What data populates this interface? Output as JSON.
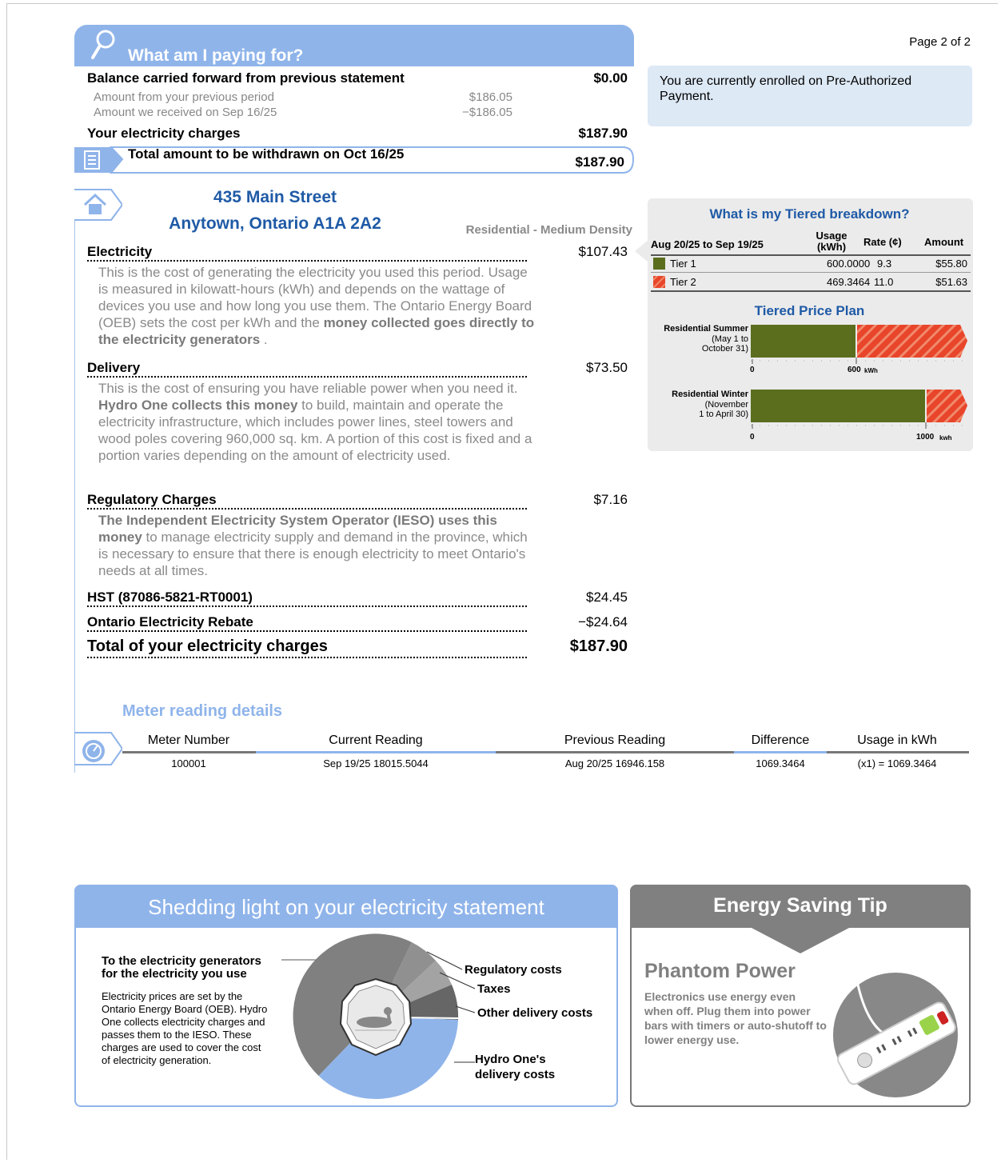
{
  "page_label": "Page 2 of 2",
  "summary": {
    "title": "What am I paying for?",
    "balance_label": "Balance carried forward from previous statement",
    "balance_value": "$0.00",
    "prev_amount_label": "Amount from your previous period",
    "prev_amount_value": "$186.05",
    "received_label": "Amount we received on Sep 16/25",
    "received_value": "−$186.05",
    "electricity_charges_label": "Your electricity charges",
    "electricity_charges_value": "$187.90",
    "withdraw_label": "Total amount to be withdrawn on Oct 16/25",
    "withdraw_value": "$187.90"
  },
  "enrollment_note": "You are currently enrolled on Pre-Authorized Payment.",
  "address": {
    "line1": "435 Main Street",
    "line2": "Anytown, Ontario A1A 2A2",
    "rate_class": "Residential - Medium Density"
  },
  "charges": {
    "electricity": {
      "label": "Electricity",
      "amount": "$107.43",
      "text_plain": "This is the cost of generating the electricity you used this period. Usage is measured in kilowatt-hours (kWh) and depends on the wattage of devices you use and how long you use them. The Ontario Energy Board (OEB) sets the cost per kWh and the ",
      "text_bold": "money collected goes directly to the electricity generators",
      "text_end": " ."
    },
    "delivery": {
      "label": "Delivery",
      "amount": "$73.50",
      "text_a": "This is the cost of ensuring you have reliable power when you need it. ",
      "text_bold": "Hydro One collects this money",
      "text_b": " to build, maintain and operate the electricity infrastructure, which includes power lines, steel towers and wood poles covering 960,000 sq. km. A portion of this cost is fixed and a portion varies depending on the amount of electricity used."
    },
    "regulatory": {
      "label": "Regulatory Charges",
      "amount": "$7.16",
      "text_bold": "The Independent Electricity System Operator (IESO) uses this money",
      "text_b": " to manage electricity supply and demand in the province, which is necessary to ensure that there is enough electricity to meet Ontario's needs at all times."
    },
    "hst": {
      "label": "HST (87086-5821-RT0001)",
      "amount": "$24.45"
    },
    "rebate": {
      "label": "Ontario Electricity Rebate",
      "amount": "−$24.64"
    },
    "total": {
      "label": "Total of your electricity charges",
      "amount": "$187.90"
    }
  },
  "tiered": {
    "title": "What is my Tiered breakdown?",
    "period": "Aug 20/25 to Sep 19/25",
    "col_usage": "Usage",
    "col_usage_unit": "(kWh)",
    "col_rate": "Rate (¢)",
    "col_amount": "Amount",
    "rows": [
      {
        "tier": "Tier 1",
        "usage": "600.0000",
        "rate": "9.3",
        "amount": "$55.80"
      },
      {
        "tier": "Tier 2",
        "usage": "469.3464",
        "rate": "11.0",
        "amount": "$51.63"
      }
    ],
    "plan_title": "Tiered Price Plan",
    "summer_label": "Residential Summer",
    "summer_sub1": "(May 1 to",
    "summer_sub2": "October 31)",
    "summer_zero": "0",
    "summer_threshold": "600",
    "winter_label": "Residential Winter",
    "winter_sub1": "(November",
    "winter_sub2": "1 to April 30)",
    "winter_zero": "0",
    "winter_threshold": "1000",
    "unit_kwh": "kWh",
    "unit_kwh_lower": "kwh",
    "colors": {
      "tier1": "#5a6e1e",
      "tier2": "#e8452a"
    }
  },
  "meter": {
    "title": "Meter reading details",
    "headers": [
      "Meter Number",
      "Current Reading",
      "Previous Reading",
      "Difference",
      "Usage in kWh"
    ],
    "values": [
      "100001",
      "Sep 19/25 18015.5044",
      "Aug 20/25 16946.158",
      "1069.3464",
      "(x1) = 1069.3464"
    ]
  },
  "shedding": {
    "title": "Shedding light on your electricity statement",
    "gen_heading1": "To the electricity generators",
    "gen_heading2": "for the electricity you use",
    "gen_text": "Electricity prices are set by the Ontario Energy Board (OEB). Hydro One collects electricity charges and passes them to the IESO. These charges are used to cover the cost of electricity generation.",
    "label_regulatory": "Regulatory costs",
    "label_taxes": "Taxes",
    "label_other": "Other delivery costs",
    "label_hydro1": "Hydro One's",
    "label_hydro2": "delivery costs"
  },
  "tip": {
    "title": "Energy Saving Tip",
    "heading": "Phantom Power",
    "text": "Electronics use energy even when off. Plug them into power bars with timers or auto-shutoff to lower energy use."
  }
}
